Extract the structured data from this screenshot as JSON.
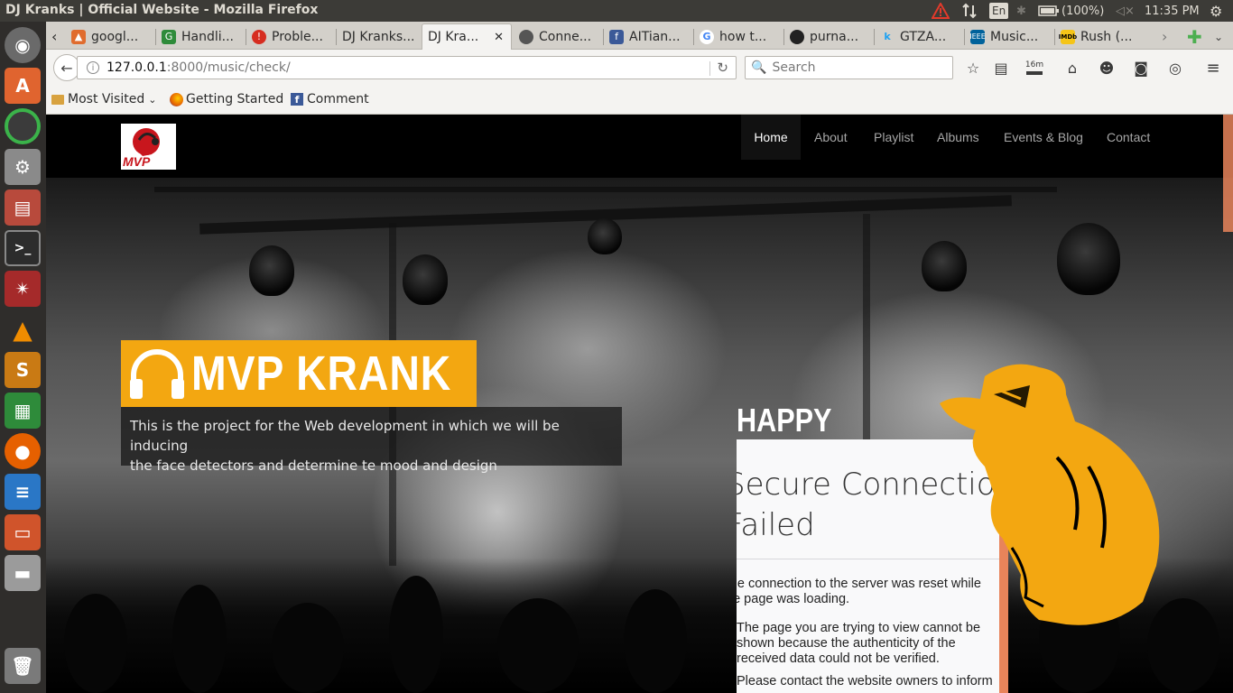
{
  "os": {
    "window_title": "DJ Kranks | Official Website - Mozilla Firefox",
    "keyboard": "En",
    "battery": "(100%)",
    "clock": "11:35 PM"
  },
  "tabs": [
    {
      "label": "googl...",
      "fav_color": "#e06c2e"
    },
    {
      "label": "Handli...",
      "fav_color": "#2e8b3a"
    },
    {
      "label": "Proble...",
      "fav_color": "#d62d20"
    },
    {
      "label": "DJ Kranks...",
      "fav_color": ""
    },
    {
      "label": "DJ Kra...",
      "fav_color": "",
      "active": true
    },
    {
      "label": "Conne...",
      "fav_color": "#555555"
    },
    {
      "label": "AITian...",
      "fav_color": "#3b5998"
    },
    {
      "label": "how t...",
      "fav_color": "#4285f4"
    },
    {
      "label": "purna...",
      "fav_color": "#222222"
    },
    {
      "label": "GTZA...",
      "fav_color": "#1da1f2"
    },
    {
      "label": "Music...",
      "fav_color": "#00629b"
    },
    {
      "label": "Rush (...",
      "fav_color": "#f5c518"
    }
  ],
  "navbar": {
    "url_host": "127.0.0.1",
    "url_rest": ":8000/music/check/",
    "search_placeholder": "Search",
    "download_badge": "16m"
  },
  "bookmarks": [
    {
      "label": "Most Visited",
      "icon": "folder-icon"
    },
    {
      "label": "Getting Started",
      "icon": "firefox-icon"
    },
    {
      "label": "Comment",
      "icon": "facebook-icon"
    }
  ],
  "site": {
    "logo_text": "MVP",
    "nav": [
      "Home",
      "About",
      "Playlist",
      "Albums",
      "Events & Blog",
      "Contact"
    ],
    "hero_title": "MVP KRANK",
    "hero_desc_line1": "This is the project for the Web development in which we will be inducing",
    "hero_desc_line2": "the face detectors and determine te mood and design",
    "mood": "HAPPY",
    "accent": "#f3a711"
  },
  "error_page": {
    "title_line1": "Secure Connection",
    "title_line2": "Failed",
    "p1_line1": "The connection to the server was reset while",
    "p1_line2": "the page was loading.",
    "p2_line1": "The page you are trying to view cannot be",
    "p2_line2": "shown because the authenticity of the",
    "p2_line3": "received data could not be verified.",
    "p3_line1": "Please contact the website owners to inform"
  }
}
